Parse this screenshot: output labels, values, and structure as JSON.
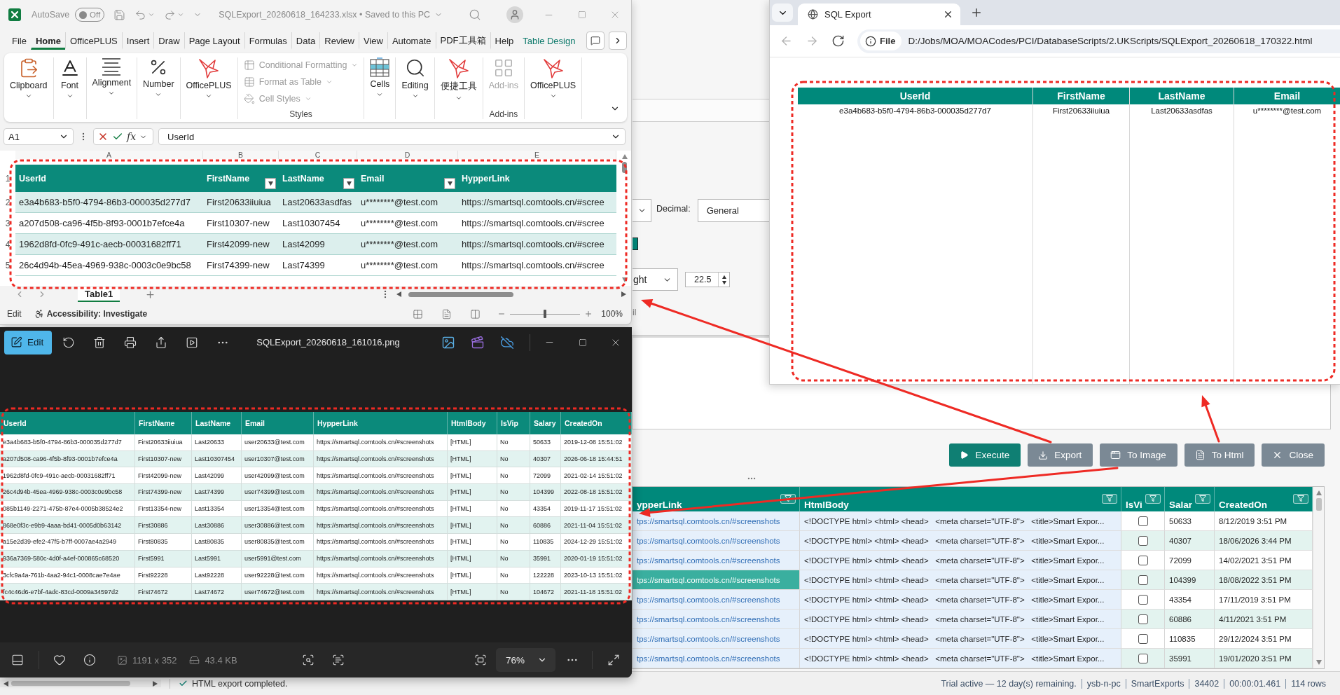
{
  "excel": {
    "title_bar": {
      "autosave_label": "AutoSave",
      "autosave": {
        "label": "Off",
        "on": false
      },
      "title": "SQLExport_20260618_164233.xlsx • Saved to this PC"
    },
    "menu_tabs": [
      {
        "label": "File",
        "kind": "standard",
        "selected": false
      },
      {
        "label": "Home",
        "kind": "standard",
        "selected": true
      },
      {
        "label": "OfficePLUS",
        "kind": "standard",
        "selected": false
      },
      {
        "label": "Insert",
        "kind": "standard",
        "selected": false
      },
      {
        "label": "Draw",
        "kind": "standard",
        "selected": false
      },
      {
        "label": "Page Layout",
        "kind": "standard",
        "selected": false
      },
      {
        "label": "Formulas",
        "kind": "standard",
        "selected": false
      },
      {
        "label": "Data",
        "kind": "standard",
        "selected": false
      },
      {
        "label": "Review",
        "kind": "standard",
        "selected": false
      },
      {
        "label": "View",
        "kind": "standard",
        "selected": false
      },
      {
        "label": "Automate",
        "kind": "standard",
        "selected": false
      },
      {
        "label": "PDF工具箱",
        "kind": "standard",
        "selected": false
      },
      {
        "label": "Help",
        "kind": "standard",
        "selected": false
      },
      {
        "label": "Table Design",
        "kind": "contextual",
        "selected": false
      }
    ],
    "ribbon": [
      {
        "kind": "large",
        "label": "Clipboard",
        "dropdown": true,
        "disabled": false
      },
      {
        "kind": "large",
        "label": "Font",
        "dropdown": true,
        "disabled": false
      },
      {
        "kind": "large",
        "label": "Alignment",
        "dropdown": true,
        "disabled": false
      },
      {
        "kind": "large",
        "label": "Number",
        "dropdown": true,
        "disabled": false
      },
      {
        "kind": "large",
        "label": "OfficePLUS",
        "dropdown": true,
        "disabled": false
      },
      {
        "kind": "stack",
        "group_label": "Styles",
        "items": [
          {
            "label": "Conditional Formatting",
            "dropdown": true,
            "disabled": true
          },
          {
            "label": "Format as Table",
            "dropdown": true,
            "disabled": true
          },
          {
            "label": "Cell Styles",
            "dropdown": true,
            "disabled": true
          }
        ]
      },
      {
        "kind": "large",
        "label": "Cells",
        "dropdown": true,
        "disabled": false
      },
      {
        "kind": "large",
        "label": "Editing",
        "dropdown": true,
        "disabled": false
      },
      {
        "kind": "large",
        "label": "便捷工具",
        "dropdown": true,
        "disabled": false
      },
      {
        "kind": "large",
        "label": "Add-ins",
        "dropdown": false,
        "disabled": true,
        "group_label": "Add-ins"
      },
      {
        "kind": "large",
        "label": "OfficePLUS",
        "dropdown": true,
        "disabled": false
      }
    ],
    "formula_bar": {
      "name_box": "A1",
      "function_button": "fx",
      "formula": "UserId"
    },
    "sheet": {
      "column_letters": [
        "A",
        "B",
        "C",
        "D",
        "E"
      ],
      "header_row": {
        "row_number": "1",
        "columns": [
          {
            "label": "UserId",
            "filter": false
          },
          {
            "label": "FirstName",
            "filter": true
          },
          {
            "label": "LastName",
            "filter": true
          },
          {
            "label": "Email",
            "filter": true
          },
          {
            "label": "HypperLink",
            "filter": false
          }
        ]
      },
      "rows": [
        {
          "row_number": "2",
          "cells": [
            "e3a4b683-b5f0-4794-86b3-000035d277d7",
            "First20633iiuiua",
            "Last20633asdfas",
            "u********@test.com",
            "https://smartsql.comtools.cn/#scree"
          ]
        },
        {
          "row_number": "3",
          "cells": [
            "a207d508-ca96-4f5b-8f93-0001b7efce4a",
            "First10307-new",
            "Last10307454",
            "u********@test.com",
            "https://smartsql.comtools.cn/#scree"
          ]
        },
        {
          "row_number": "4",
          "cells": [
            "1962d8fd-0fc9-491c-aecb-00031682ff71",
            "First42099-new",
            "Last42099",
            "u********@test.com",
            "https://smartsql.comtools.cn/#scree"
          ]
        },
        {
          "row_number": "5",
          "cells": [
            "26c4d94b-45ea-4969-938c-0003c0e9bc58",
            "First74399-new",
            "Last74399",
            "u********@test.com",
            "https://smartsql.comtools.cn/#scree"
          ]
        }
      ]
    },
    "sheet_tabs": [
      {
        "label": "Table1",
        "selected": true
      }
    ],
    "status_bar": {
      "mode": "Edit",
      "accessibility": "Accessibility: Investigate",
      "zoom_slider": {
        "level": 0.5
      },
      "zoom": "100%"
    }
  },
  "photos": {
    "toolbar": {
      "edit_button": "Edit",
      "file_name": "SQLExport_20260618_161016.png"
    },
    "image": {
      "columns": [
        "UserId",
        "FirstName",
        "LastName",
        "Email",
        "HypperLink",
        "HtmlBody",
        "IsVip",
        "Salary",
        "CreatedOn"
      ],
      "rows": [
        [
          "e3a4b683-b5f0-4794-86b3-000035d277d7",
          "First20633iiuiua",
          "Last20633",
          "user20633@test.com",
          "https://smartsql.comtools.cn/#screenshots",
          "[HTML]",
          "No",
          "50633",
          "2019-12-08 15:51:02"
        ],
        [
          "a207d508-ca96-4f5b-8f93-0001b7efce4a",
          "First10307-new",
          "Last10307454",
          "user10307@test.com",
          "https://smartsql.comtools.cn/#screenshots",
          "[HTML]",
          "No",
          "40307",
          "2026-06-18 15:44:51"
        ],
        [
          "1962d8fd-0fc9-491c-aecb-00031682ff71",
          "First42099-new",
          "Last42099",
          "user42099@test.com",
          "https://smartsql.comtools.cn/#screenshots",
          "[HTML]",
          "No",
          "72099",
          "2021-02-14 15:51:02"
        ],
        [
          "26c4d94b-45ea-4969-938c-0003c0e9bc58",
          "First74399-new",
          "Last74399",
          "user74399@test.com",
          "https://smartsql.comtools.cn/#screenshots",
          "[HTML]",
          "No",
          "104399",
          "2022-08-18 15:51:02"
        ],
        [
          "085b1149-2271-475b-87e4-0005b38524e2",
          "First13354-new",
          "Last13354",
          "user13354@test.com",
          "https://smartsql.comtools.cn/#screenshots",
          "[HTML]",
          "No",
          "43354",
          "2019-11-17 15:51:02"
        ],
        [
          "868e0f3c-e9b9-4aaa-bd41-0005d0b63142",
          "First30886",
          "Last30886",
          "user30886@test.com",
          "https://smartsql.comtools.cn/#screenshots",
          "[HTML]",
          "No",
          "60886",
          "2021-11-04 15:51:02"
        ],
        [
          "a15e2d39-efe2-47f5-b7ff-0007ae4a2949",
          "First80835",
          "Last80835",
          "user80835@test.com",
          "https://smartsql.comtools.cn/#screenshots",
          "[HTML]",
          "No",
          "110835",
          "2024-12-29 15:51:02"
        ],
        [
          "936a7369-580c-4d0f-a4ef-000865c68520",
          "First5991",
          "Last5991",
          "user5991@test.com",
          "https://smartsql.comtools.cn/#screenshots",
          "[HTML]",
          "No",
          "35991",
          "2020-01-19 15:51:02"
        ],
        [
          "3cfc9a4a-761b-4aa2-94c1-0008cae7e4ae",
          "First92228",
          "Last92228",
          "user92228@test.com",
          "https://smartsql.comtools.cn/#screenshots",
          "[HTML]",
          "No",
          "122228",
          "2023-10-13 15:51:02"
        ],
        [
          "fc4c46d6-e7bf-4adc-83cd-0009a34597d2",
          "First74672",
          "Last74672",
          "user74672@test.com",
          "https://smartsql.comtools.cn/#screenshots",
          "[HTML]",
          "No",
          "104672",
          "2021-11-18 15:51:02"
        ]
      ]
    },
    "footer": {
      "dimensions": "1191 x 352",
      "file_size": "43.4 KB",
      "zoom": "76%"
    }
  },
  "browser": {
    "tab": {
      "title": "SQL Export"
    },
    "nav_buttons": [
      {
        "kind": "back",
        "disabled": true
      },
      {
        "kind": "forward",
        "disabled": true
      },
      {
        "kind": "reload",
        "disabled": false
      }
    ],
    "address": {
      "chip": "File",
      "url": "D:/Jobs/MOA/MOACodes/PCI/DatabaseScripts/2.UKScripts/SQLExport_20260618_170322.html"
    },
    "table": {
      "columns": [
        "UserId",
        "FirstName",
        "LastName",
        "Email"
      ],
      "rows": [
        [
          "e3a4b683-b5f0-4794-86b3-000035d277d7",
          "First20633iiuiua",
          "Last20633asdfas",
          "u********@test.com"
        ]
      ]
    }
  },
  "app": {
    "settings": {
      "decimal_label": "Decimal:",
      "decimal_value": "General",
      "alignment_value": "ght",
      "size_value": "22.5",
      "cut_label": "il"
    },
    "buttons": [
      {
        "label": "Execute",
        "kind": "primary"
      },
      {
        "label": "Export",
        "kind": "secondary"
      },
      {
        "label": "To Image",
        "kind": "secondary"
      },
      {
        "label": "To Html",
        "kind": "secondary"
      },
      {
        "label": "Close",
        "kind": "secondary"
      }
    ],
    "grid": {
      "columns": [
        {
          "label": "ypperLink",
          "selected": true
        },
        {
          "label": "HtmlBody",
          "selected": true
        },
        {
          "label": "IsVi",
          "selected": false
        },
        {
          "label": "Salar",
          "selected": false
        },
        {
          "label": "CreatedOn",
          "selected": false
        }
      ],
      "rows": [
        {
          "link": "tps://smartsql.comtools.cn/#screenshots",
          "html": "<!DOCTYPE html> <html> <head>   <meta charset=\"UTF-8\">   <title>Smart Expor...",
          "is_vip": false,
          "salary": "50633",
          "created_on": "8/12/2019 3:51 PM",
          "selected": false
        },
        {
          "link": "tps://smartsql.comtools.cn/#screenshots",
          "html": "<!DOCTYPE html> <html> <head>   <meta charset=\"UTF-8\">   <title>Smart Expor...",
          "is_vip": false,
          "salary": "40307",
          "created_on": "18/06/2026 3:44 PM",
          "selected": false
        },
        {
          "link": "tps://smartsql.comtools.cn/#screenshots",
          "html": "<!DOCTYPE html> <html> <head>   <meta charset=\"UTF-8\">   <title>Smart Expor...",
          "is_vip": false,
          "salary": "72099",
          "created_on": "14/02/2021 3:51 PM",
          "selected": false
        },
        {
          "link": "tps://smartsql.comtools.cn/#screenshots",
          "html": "<!DOCTYPE html> <html> <head>   <meta charset=\"UTF-8\">   <title>Smart Expor...",
          "is_vip": false,
          "salary": "104399",
          "created_on": "18/08/2022 3:51 PM",
          "selected": true
        },
        {
          "link": "tps://smartsql.comtools.cn/#screenshots",
          "html": "<!DOCTYPE html> <html> <head>   <meta charset=\"UTF-8\">   <title>Smart Expor...",
          "is_vip": false,
          "salary": "43354",
          "created_on": "17/11/2019 3:51 PM",
          "selected": false
        },
        {
          "link": "tps://smartsql.comtools.cn/#screenshots",
          "html": "<!DOCTYPE html> <html> <head>   <meta charset=\"UTF-8\">   <title>Smart Expor...",
          "is_vip": false,
          "salary": "60886",
          "created_on": "4/11/2021 3:51 PM",
          "selected": false
        },
        {
          "link": "tps://smartsql.comtools.cn/#screenshots",
          "html": "<!DOCTYPE html> <html> <head>   <meta charset=\"UTF-8\">   <title>Smart Expor...",
          "is_vip": false,
          "salary": "110835",
          "created_on": "29/12/2024 3:51 PM",
          "selected": false
        },
        {
          "link": "tps://smartsql.comtools.cn/#screenshots",
          "html": "<!DOCTYPE html> <html> <head>   <meta charset=\"UTF-8\">   <title>Smart Expor...",
          "is_vip": false,
          "salary": "35991",
          "created_on": "19/01/2020 3:51 PM",
          "selected": false
        }
      ]
    },
    "status_bar": {
      "message": "HTML export completed.",
      "items": [
        "Trial active — 12 day(s) remaining.",
        "ysb-n-pc",
        "SmartExports",
        "34402",
        "00:00:01.461",
        "114 rows"
      ]
    }
  }
}
